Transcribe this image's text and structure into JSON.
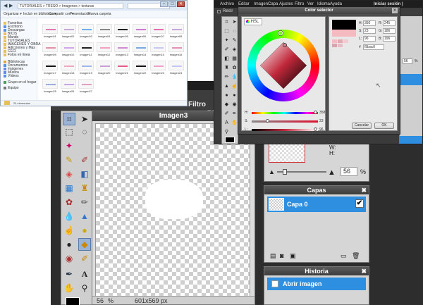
{
  "editor": {
    "menu": [
      "Archivo",
      "Editar",
      "Imagen",
      "Capa",
      "Ajustes",
      "Filtro",
      "Ver",
      "Idioma",
      "Ayuda"
    ],
    "menu_right": [
      "Iniciar sesión",
      "Inscribirse"
    ],
    "options_filtro": "Filtro",
    "options_ancho": "ncho:",
    "canvas_title": "Imagen3",
    "zoom_value": "56",
    "zoom_unit": "%",
    "canvas_size": "601x569 px"
  },
  "navigator": {
    "width_label": "W:",
    "height_label": "H:",
    "zoom_value": "56",
    "zoom_unit": "%"
  },
  "layers": {
    "title": "Capas",
    "items": [
      {
        "label": "Capa 0"
      }
    ]
  },
  "history": {
    "title": "Historia",
    "items": [
      {
        "label": "Abrir imagen"
      }
    ]
  },
  "explorer": {
    "address": "TUTORIALES > TRESO > Imagenes > texturas",
    "commands": [
      "Organizar ▾",
      "Incluir en biblioteca ▾",
      "Compartir con ▾",
      "Presentación",
      "Nueva carpeta"
    ],
    "favorites_header": "Favoritos",
    "nav_items": [
      "Favoritos",
      "Escritorio",
      "Descargas",
      "BICIS",
      "Mando",
      "TUTORIALES",
      "IMAGENES Y OBRA",
      "Adicciones y Mas",
      "CECI",
      "Fotos en linea",
      "Bibliotecas",
      "Documentos",
      "Imágenes",
      "Música",
      "Vídeos",
      "Grupo en el hogar",
      "Equipo"
    ],
    "thumbs": [
      "Imagen01",
      "Imagen02",
      "Imagen03",
      "Imagen04",
      "Imagen05",
      "Imagen06",
      "Imagen07",
      "Imagen08",
      "Imagen09",
      "Imagen10",
      "Imagen11",
      "Imagen12",
      "Imagen13",
      "Imagen14",
      "Imagen15",
      "Imagen16",
      "Imagen17",
      "Imagen18",
      "Imagen19",
      "Imagen20",
      "Imagen21",
      "Imagen22",
      "Imagen23",
      "Imagen24",
      "Imagen25",
      "Imagen26",
      "Imagen27"
    ],
    "status": "24 elementos"
  },
  "editor2": {
    "menu": [
      "Archivo",
      "Editar",
      "Imagen",
      "Capa",
      "Ajustes",
      "Filtro",
      "Ver",
      "Idioma",
      "Ayuda"
    ],
    "menu_right": "Iniciar sesión | Inscribirse",
    "option_label": "Restr",
    "panel_zoom": "56",
    "panel_zoom_unit": "%"
  },
  "color_selector": {
    "title": "Color selector",
    "tab": "HSL",
    "h_label": "H:",
    "h_value": "350",
    "s_label": "S:",
    "s_value": "23",
    "l_label": "L:",
    "l_value": "96",
    "r_label": "R:",
    "r_value": "245",
    "g_label": "G:",
    "g_value": "186",
    "b_label": "B:",
    "b_value": "196",
    "hex_label": "#",
    "hex_value": "f5bac0",
    "slider_h_label": "H:",
    "slider_h_value": "358",
    "slider_s_label": "S:",
    "slider_s_value": "23",
    "slider_l_label": "L:",
    "slider_l_value": "96",
    "cancel_label": "Cancelar",
    "ok_label": "OK",
    "selected_color": "#f5bac0",
    "previous_color": "#000000"
  }
}
